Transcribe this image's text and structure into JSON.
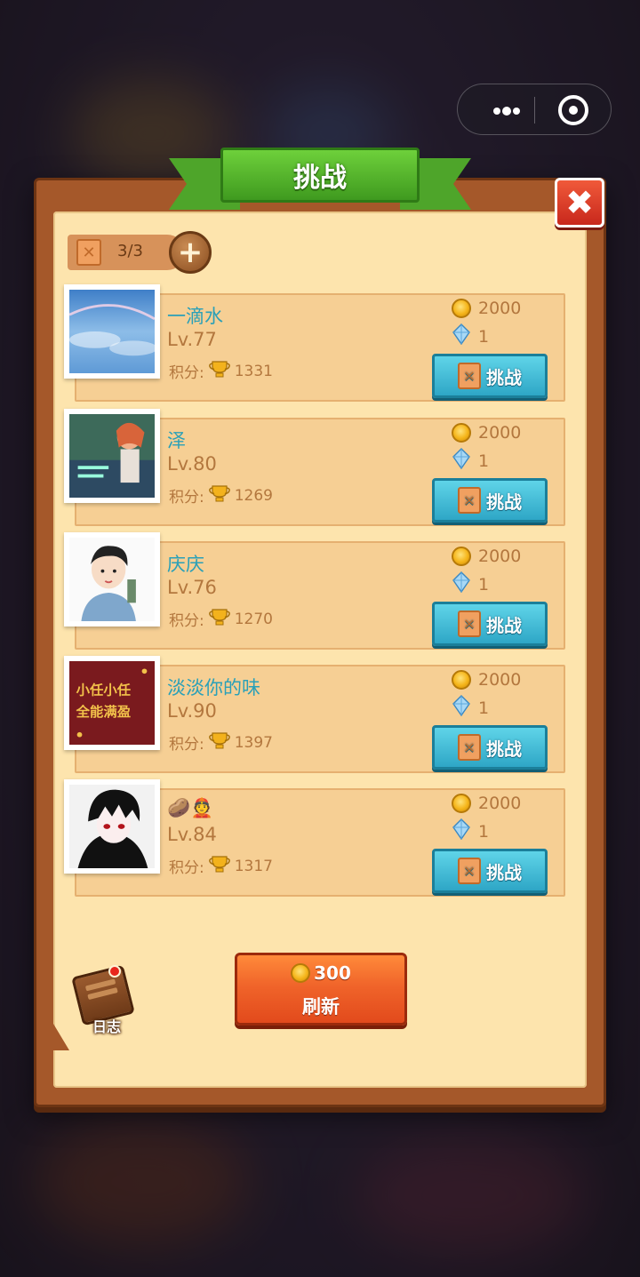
{
  "capsule": {
    "menu_icon": "more-dots-icon",
    "close_icon": "target-circle-icon"
  },
  "title": "挑战",
  "close_symbol": "✖",
  "tickets": {
    "count": "3/3",
    "add_symbol": "+"
  },
  "challenge_label": "挑战",
  "score_label": "积分:",
  "opponents": [
    {
      "name": "一滴水",
      "level": "Lv.77",
      "score": "1331",
      "gold": "2000",
      "crystal": "1",
      "avatar": "sky-rainbow"
    },
    {
      "name": "泽",
      "level": "Lv.80",
      "score": "1269",
      "gold": "2000",
      "crystal": "1",
      "avatar": "game-character"
    },
    {
      "name": "庆庆",
      "level": "Lv.76",
      "score": "1270",
      "gold": "2000",
      "crystal": "1",
      "avatar": "cartoon-boy"
    },
    {
      "name": "淡淡你的味",
      "level": "Lv.90",
      "score": "1397",
      "gold": "2000",
      "crystal": "1",
      "avatar": "red-calligraphy"
    },
    {
      "name": "🥔👲",
      "level": "Lv.84",
      "score": "1317",
      "gold": "2000",
      "crystal": "1",
      "avatar": "anime-dark-boy"
    }
  ],
  "log": {
    "label": "日志"
  },
  "refresh": {
    "cost": "300",
    "label": "刷新"
  },
  "colors": {
    "name": "#2aa0b8",
    "muted": "#b3773e",
    "panel": "#fde4ad",
    "button_blue": "#2ea6c6",
    "button_orange": "#f0642a"
  }
}
